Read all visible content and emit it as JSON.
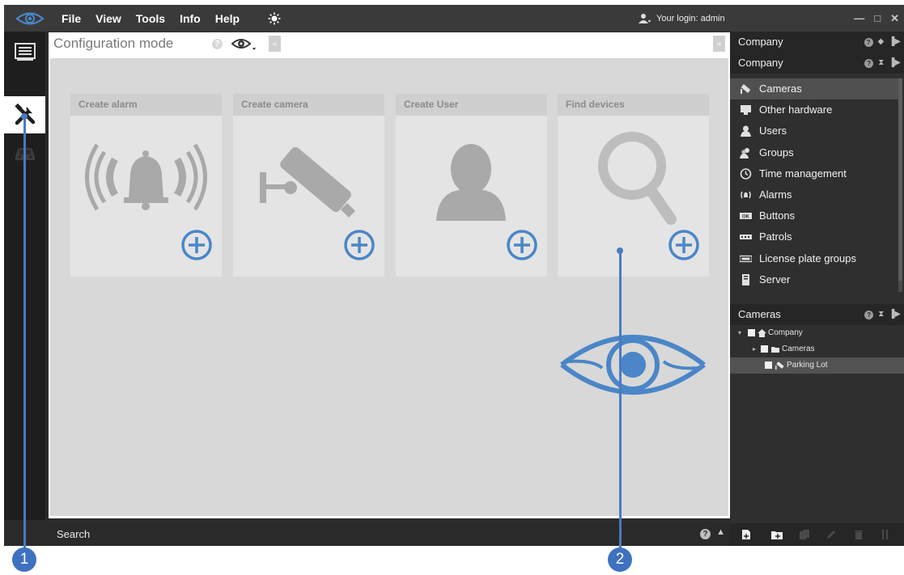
{
  "menu": {
    "items": [
      "File",
      "View",
      "Tools",
      "Info",
      "Help"
    ]
  },
  "login": {
    "text": "Your login: admin"
  },
  "window_controls": {
    "minimize": "—",
    "maximize": "□",
    "close": "✕"
  },
  "main": {
    "mode_title": "Configuration mode",
    "collapse_left": "«",
    "collapse_right": "»"
  },
  "tiles": [
    {
      "title": "Create alarm",
      "icon": "alarm-bell-icon"
    },
    {
      "title": "Create camera",
      "icon": "camera-icon"
    },
    {
      "title": "Create User",
      "icon": "user-icon"
    },
    {
      "title": "Find devices",
      "icon": "magnifier-icon"
    }
  ],
  "search": {
    "label": "Search"
  },
  "right_panel": {
    "header1": "Company",
    "header2": "Company",
    "items": [
      {
        "label": "Cameras",
        "icon": "camera-icon",
        "selected": true
      },
      {
        "label": "Other hardware",
        "icon": "monitor-icon"
      },
      {
        "label": "Users",
        "icon": "user-icon"
      },
      {
        "label": "Groups",
        "icon": "group-icon"
      },
      {
        "label": "Time management",
        "icon": "clock-icon"
      },
      {
        "label": "Alarms",
        "icon": "alarm-icon"
      },
      {
        "label": "Buttons",
        "icon": "ok-button-icon"
      },
      {
        "label": "Patrols",
        "icon": "patrol-icon"
      },
      {
        "label": "License plate groups",
        "icon": "license-plate-icon"
      },
      {
        "label": "Server",
        "icon": "server-icon"
      }
    ],
    "cameras_header": "Cameras",
    "tree": [
      {
        "label": "Company",
        "level": 0
      },
      {
        "label": "Cameras",
        "level": 1
      },
      {
        "label": "Parking Lot",
        "level": 2,
        "selected": true
      }
    ]
  },
  "callouts": [
    "1",
    "2"
  ],
  "colors": {
    "accent": "#4a86c8",
    "callout": "#3e71c0",
    "titlebar": "#3a3a3a",
    "panel": "#2f2f2f"
  }
}
